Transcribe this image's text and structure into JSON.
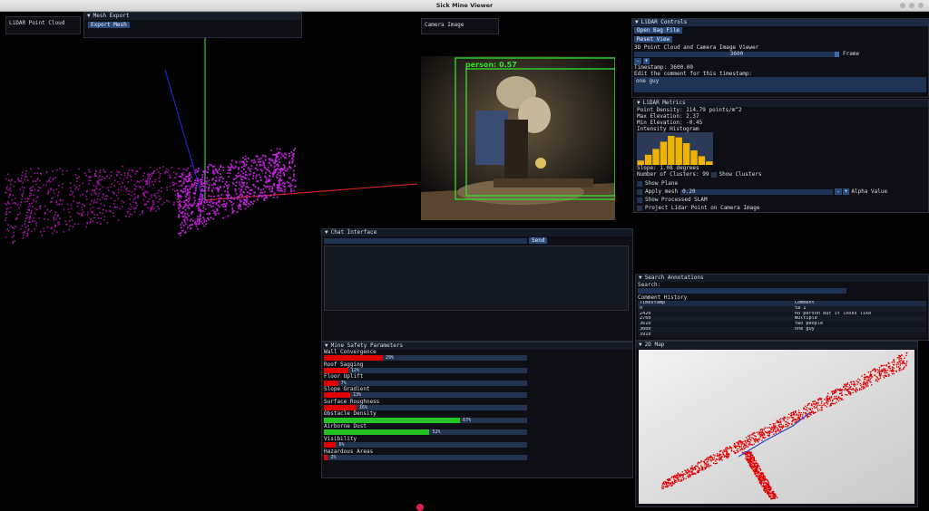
{
  "window": {
    "title": "Sick Mine Viewer"
  },
  "lidar_view": {
    "label": "LiDAR Point Cloud"
  },
  "mesh_export": {
    "title": "Mesh Export",
    "button": "Export Mesh"
  },
  "camera": {
    "label": "Camera Image",
    "detections": [
      {
        "label": "person: 0.57"
      }
    ]
  },
  "lidar_controls": {
    "title": "LiDAR Controls",
    "open_button": "Open Bag File",
    "reset_button": "Reset View",
    "viewer_label": "3D Point Cloud and Camera Image Viewer",
    "frame_value": "3600",
    "frame_label": "Frame",
    "minus": "-",
    "plus": "+",
    "timestamp": "Timestamp: 3600.00",
    "comment_prompt": "Edit the comment for this timestamp:",
    "comment_value": "one guy"
  },
  "lidar_metrics": {
    "title": "LiDAR Metrics",
    "point_density": "Point Density: 114.79 points/m^2",
    "max_elevation": "Max Elevation: 2.37",
    "min_elevation": "Min Elevation: -0.45",
    "histogram_label": "Intensity Histogram",
    "histogram": [
      0.15,
      0.35,
      0.55,
      0.8,
      1.0,
      0.95,
      0.75,
      0.5,
      0.3,
      0.12
    ],
    "slope": "Slope: 1.08 degrees",
    "clusters": "Number of Clusters: 99",
    "show_clusters": "Show Clusters",
    "show_plane": "Show Plane",
    "apply_mesh": "Apply mesh",
    "alpha_value": "0.20",
    "alpha_label": "Alpha Value",
    "show_slam": "Show Processed SLAM",
    "project": "Project Lidar Point on Camera Image"
  },
  "chat": {
    "title": "Chat Interface",
    "send": "Send"
  },
  "safety": {
    "title": "Mine Safety Parameters",
    "params": [
      {
        "label": "Wall Convergence",
        "value": 0.29,
        "text": "29%",
        "color": "#e00000"
      },
      {
        "label": "Roof Sagging",
        "value": 0.12,
        "text": "12%",
        "color": "#e00000"
      },
      {
        "label": "Floor Uplift",
        "value": 0.07,
        "text": "7%",
        "color": "#e00000"
      },
      {
        "label": "Slope Gradient",
        "value": 0.13,
        "text": "13%",
        "color": "#e00000"
      },
      {
        "label": "Surface Roughness",
        "value": 0.16,
        "text": "16%",
        "color": "#e00000"
      },
      {
        "label": "Obstacle Density",
        "value": 0.67,
        "text": "67%",
        "color": "#22c322"
      },
      {
        "label": "Airborne Dust",
        "value": 0.52,
        "text": "52%",
        "color": "#22c322"
      },
      {
        "label": "Visibility",
        "value": 0.06,
        "text": "6%",
        "color": "#e00000"
      },
      {
        "label": "Hazardous Areas",
        "value": 0.02,
        "text": "2%",
        "color": "#e00000"
      }
    ]
  },
  "annotations": {
    "title": "Search Annotations",
    "search_label": "Search:",
    "history_label": "Comment History",
    "col_timestamp": "Timestamp",
    "col_comment": "Comment",
    "rows": [
      {
        "ts": "0",
        "comment": "ta 1"
      },
      {
        "ts": "2420",
        "comment": "no person but it looks like"
      },
      {
        "ts": "2760",
        "comment": "multiple"
      },
      {
        "ts": "3610",
        "comment": "two people"
      },
      {
        "ts": "3600",
        "comment": "one guy"
      },
      {
        "ts": "3910",
        "comment": ""
      }
    ]
  },
  "map2d": {
    "title": "2D Map"
  }
}
